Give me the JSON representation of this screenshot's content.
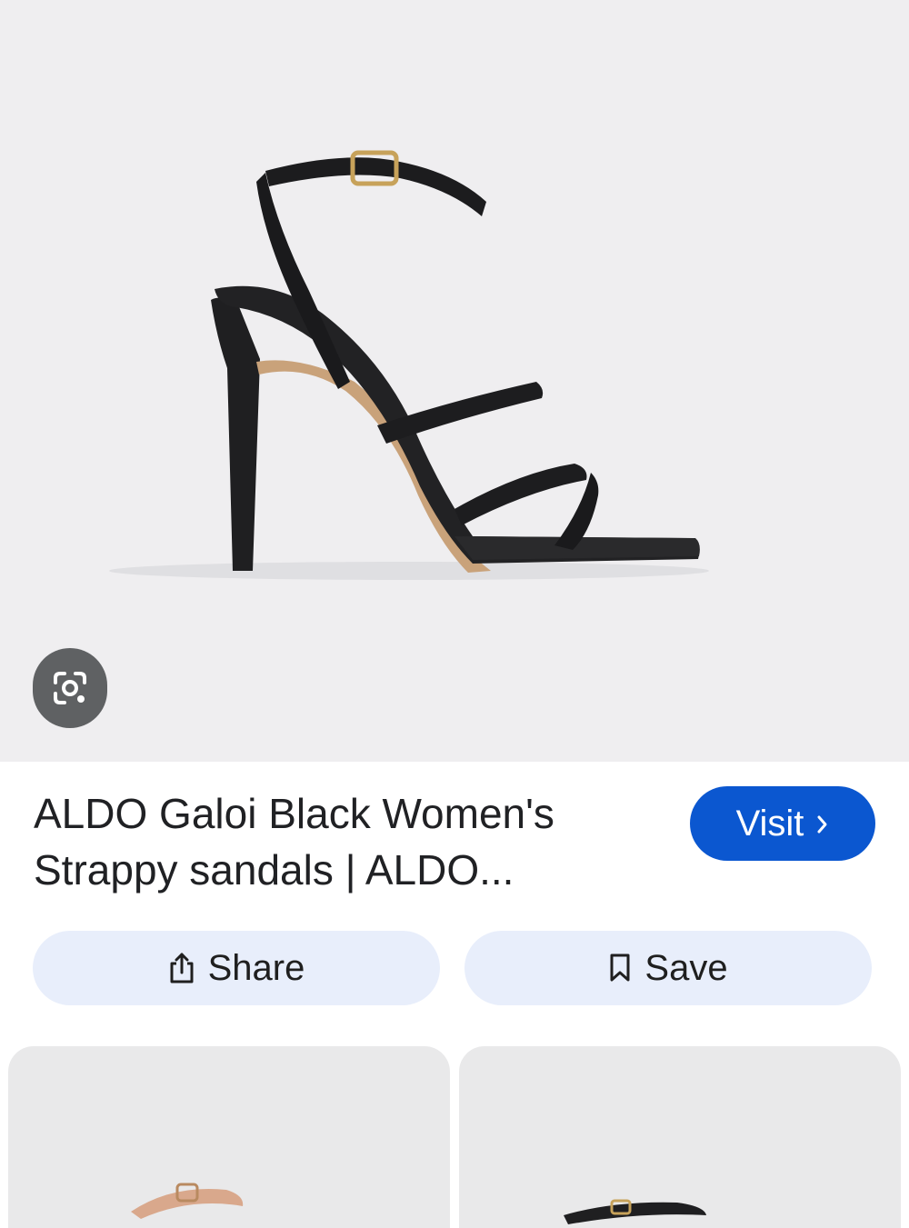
{
  "result": {
    "title": "ALDO Galoi Black Women's Strappy sandals | ALDO...",
    "visit_label": "Visit"
  },
  "actions": {
    "share_label": "Share",
    "save_label": "Save"
  },
  "icons": {
    "lens": "google-lens-icon",
    "chevron": "chevron-right-icon",
    "share": "share-icon",
    "save": "bookmark-icon"
  },
  "colors": {
    "hero_background": "#efeef0",
    "visit_button": "#0b57d0",
    "action_button": "#e8eefb",
    "lens_button": "#5f6163"
  }
}
